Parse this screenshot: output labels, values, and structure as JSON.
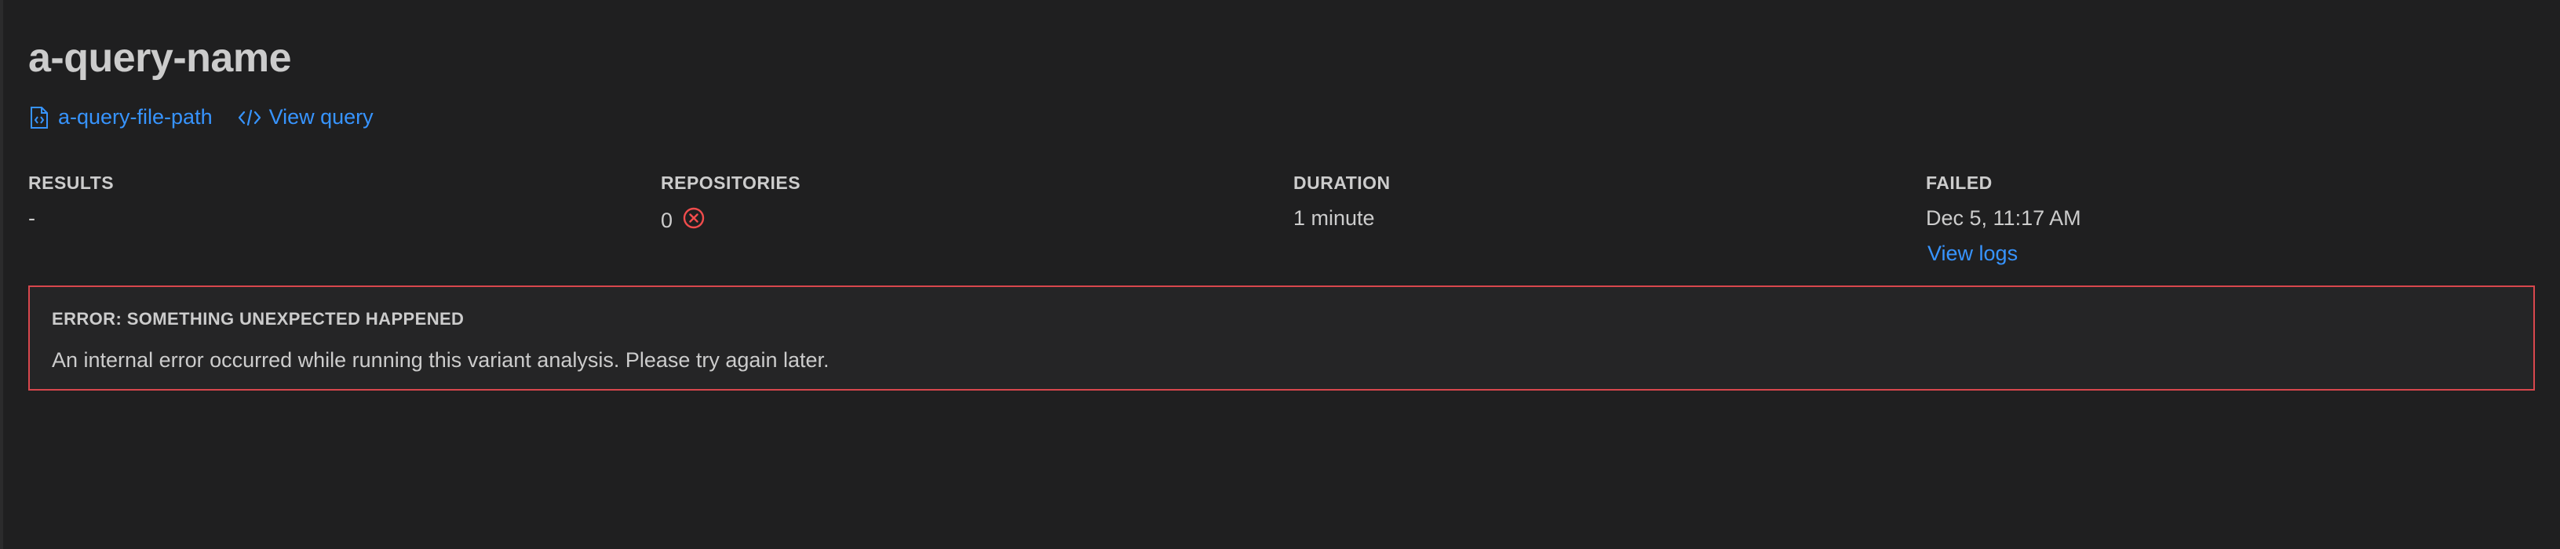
{
  "title": "a-query-name",
  "links": {
    "file_path": {
      "label": "a-query-file-path",
      "icon": "file-code-icon"
    },
    "view_query": {
      "label": "View query",
      "icon": "code-icon"
    }
  },
  "stats": {
    "results": {
      "label": "RESULTS",
      "value": "-"
    },
    "repositories": {
      "label": "REPOSITORIES",
      "value": "0",
      "icon": "error-circle-icon"
    },
    "duration": {
      "label": "DURATION",
      "value": "1 minute"
    },
    "failed": {
      "label": "FAILED",
      "value": "Dec 5, 11:17 AM",
      "link": "View logs"
    }
  },
  "error": {
    "title": "ERROR: SOMETHING UNEXPECTED HAPPENED",
    "message": "An internal error occurred while running this variant analysis. Please try again later."
  },
  "colors": {
    "background": "#1f1f20",
    "text": "#cccccc",
    "link": "#3794ff",
    "error": "#f14c4c",
    "error_border": "#d8474d"
  }
}
